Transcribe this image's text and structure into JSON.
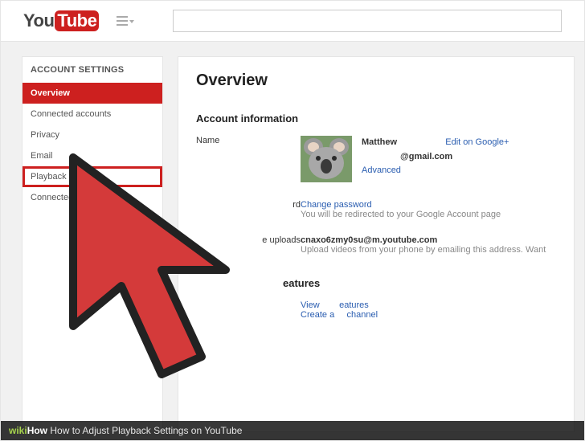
{
  "header": {
    "logo_you": "You",
    "logo_tube": "Tube",
    "search_placeholder": ""
  },
  "sidebar": {
    "title": "ACCOUNT SETTINGS",
    "items": [
      {
        "label": "Overview",
        "active": true,
        "highlighted": false
      },
      {
        "label": "Connected accounts",
        "active": false,
        "highlighted": false
      },
      {
        "label": "Privacy",
        "active": false,
        "highlighted": false
      },
      {
        "label": "Email",
        "active": false,
        "highlighted": false
      },
      {
        "label": "Playback",
        "active": false,
        "highlighted": true
      },
      {
        "label": "Connected",
        "active": false,
        "highlighted": false
      }
    ]
  },
  "main": {
    "page_title": "Overview",
    "account_info": {
      "section_title": "Account information",
      "name_label": "Name",
      "name_value": "Matthew",
      "edit_link": "Edit on Google+",
      "email_value": "@gmail.com",
      "advanced_link": "Advanced"
    },
    "password": {
      "label": "rd",
      "change_link": "Change password",
      "hint": "You will be redirected to your Google Account page"
    },
    "uploads": {
      "label": "e uploads",
      "email_value": "cnaxo6zmy0su@m.youtube.com",
      "hint": "Upload videos from your phone by emailing this address. Want"
    },
    "features": {
      "section_title": "eatures",
      "view_link": "View",
      "view_link_tail": "eatures",
      "create_link": "Create a",
      "create_link_tail": "channel"
    }
  },
  "footer": {
    "wiki": "wiki",
    "how": "How",
    "title": "How to Adjust Playback Settings on YouTube"
  }
}
